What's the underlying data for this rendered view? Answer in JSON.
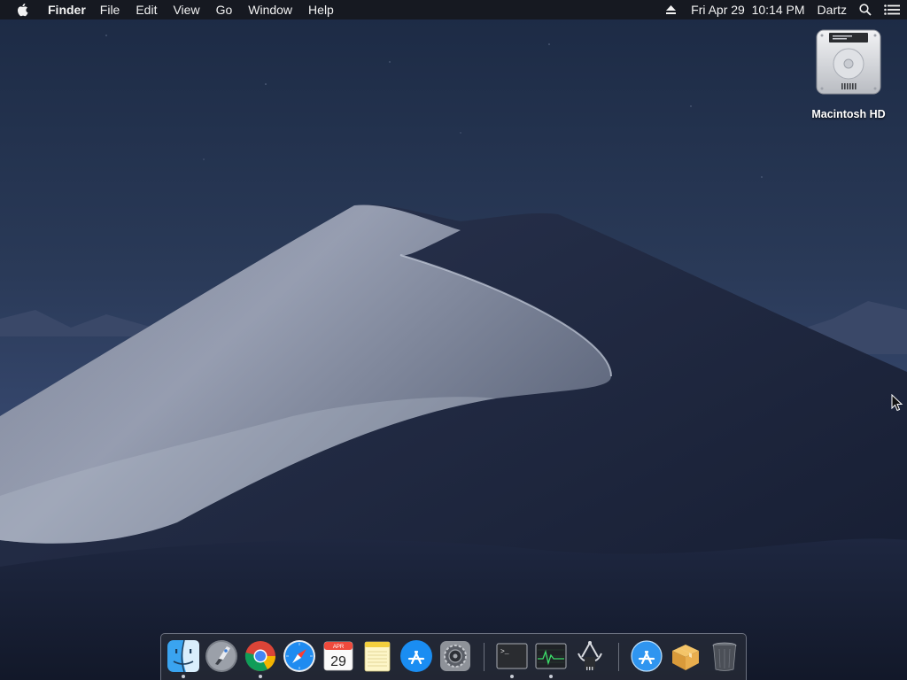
{
  "menubar": {
    "app_name": "Finder",
    "menus": [
      "File",
      "Edit",
      "View",
      "Go",
      "Window",
      "Help"
    ],
    "clock": "Fri Apr 29  10:14 PM",
    "user": "Dartz"
  },
  "desktop": {
    "icons": [
      {
        "label": "Macintosh HD",
        "icon": "hard-drive-icon"
      }
    ]
  },
  "dock": {
    "apps": [
      {
        "name": "Finder",
        "icon": "finder-icon",
        "running": true
      },
      {
        "name": "Launchpad",
        "icon": "launchpad-icon",
        "running": false
      },
      {
        "name": "Google Chrome",
        "icon": "chrome-icon",
        "running": true
      },
      {
        "name": "Safari",
        "icon": "safari-icon",
        "running": false
      },
      {
        "name": "Calendar",
        "icon": "calendar-icon",
        "running": false,
        "month": "APR",
        "day": "29"
      },
      {
        "name": "Notes",
        "icon": "notes-icon",
        "running": false
      },
      {
        "name": "App Store",
        "icon": "app-store-icon",
        "running": false
      },
      {
        "name": "System Preferences",
        "icon": "system-preferences-icon",
        "running": false
      }
    ],
    "utilities": [
      {
        "name": "Terminal",
        "icon": "terminal-icon",
        "running": true,
        "prompt": ">_"
      },
      {
        "name": "Activity Monitor",
        "icon": "activity-monitor-icon",
        "running": true
      },
      {
        "name": "System Information",
        "icon": "system-information-icon",
        "running": false
      }
    ],
    "extras": [
      {
        "name": "Applications",
        "icon": "applications-folder-icon"
      },
      {
        "name": "Archive Utility",
        "icon": "package-box-icon"
      },
      {
        "name": "Trash",
        "icon": "trash-icon"
      }
    ]
  },
  "colors": {
    "sky": "#1e2b45",
    "dune_light": "#9ea5b7",
    "dune_dark": "#1a2238",
    "menubar_bg": "#16181e"
  }
}
